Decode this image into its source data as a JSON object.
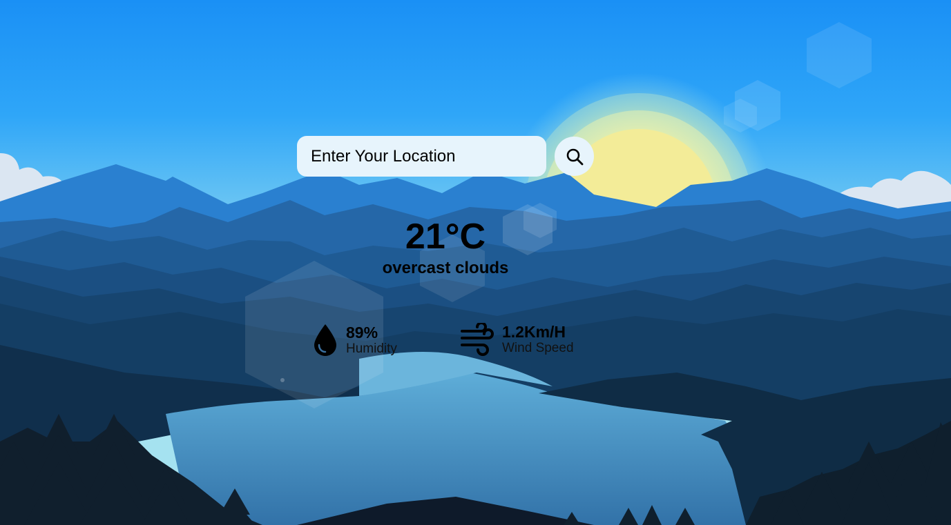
{
  "search": {
    "placeholder": "Enter Your Location",
    "value": "",
    "button_icon": "search-icon"
  },
  "weather": {
    "temperature": "21°C",
    "description": "overcast clouds"
  },
  "details": {
    "humidity": {
      "value": "89%",
      "label": "Humidity",
      "icon": "water-drop-icon"
    },
    "wind": {
      "value": "1.2Km/H",
      "label": "Wind Speed",
      "icon": "wind-icon"
    }
  },
  "colors": {
    "sky_top": "#1a90f5",
    "sky_bottom": "#8fd5ee",
    "sun": "#f3ec98",
    "input_background": "#e7f4fc",
    "lake": "#4a9bd0",
    "forest": "#0d1e2a"
  }
}
